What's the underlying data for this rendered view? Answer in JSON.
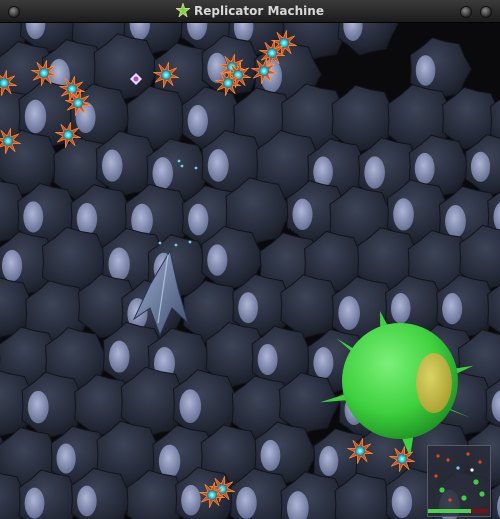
{
  "window": {
    "title": "Replicator Machine",
    "icon": "green-star-icon"
  },
  "hud": {
    "health_fraction": 0.72,
    "minimap_icon": "minimap"
  },
  "colors": {
    "background": "#0a0a0d",
    "cell": "#2b3140",
    "cell_eye": "#a9b4d8",
    "blob": "#3ed13e",
    "blob_eye": "#d8c24a",
    "enemy_spike": "#e04a1a",
    "enemy_core": "#24c6d8",
    "ship": "#5c6f92",
    "health": "#4fd04f",
    "health_bg": "#7a1111"
  }
}
